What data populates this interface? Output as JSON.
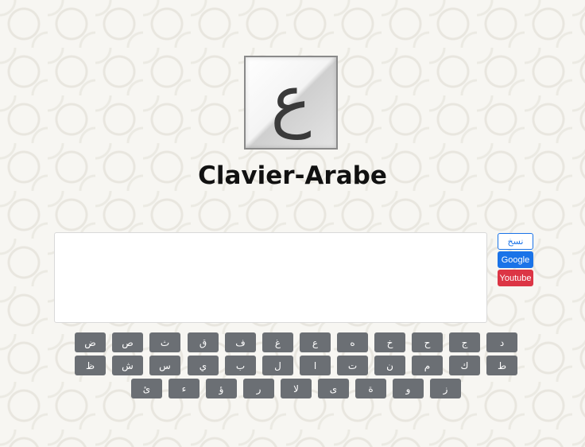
{
  "logo": {
    "glyph": "ع"
  },
  "title": "Clavier-Arabe",
  "textarea": {
    "value": ""
  },
  "buttons": {
    "copy": "نسخ",
    "google": "Google",
    "youtube": "Youtube"
  },
  "keyboard": {
    "row1": [
      "ض",
      "ص",
      "ث",
      "ق",
      "ف",
      "غ",
      "ع",
      "ه",
      "خ",
      "ح",
      "ج",
      "د"
    ],
    "row2": [
      "ظ",
      "ش",
      "س",
      "ي",
      "ب",
      "ل",
      "ا",
      "ت",
      "ن",
      "م",
      "ك",
      "ط"
    ],
    "row3": [
      "ئ",
      "ء",
      "ؤ",
      "ر",
      "لا",
      "ى",
      "ة",
      "و",
      "ز"
    ]
  }
}
